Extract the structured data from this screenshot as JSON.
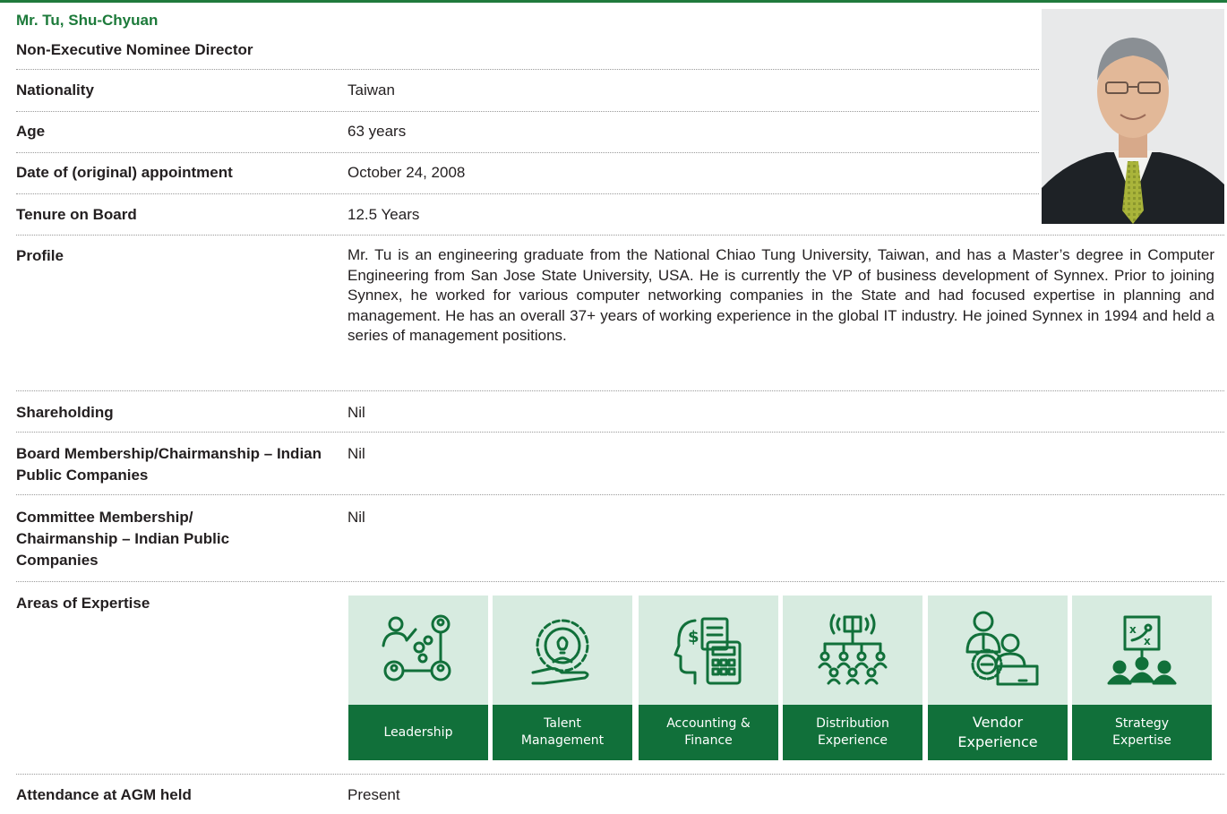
{
  "header": {
    "name": "Mr. Tu, Shu-Chyuan",
    "role": "Non-Executive Nominee Director"
  },
  "rows": [
    {
      "label": "Nationality",
      "value": "Taiwan"
    },
    {
      "label": "Age",
      "value": "63 years"
    },
    {
      "label": "Date of (original) appointment",
      "value": "October 24, 2008"
    },
    {
      "label": "Tenure on Board",
      "value": "12.5 Years"
    },
    {
      "label": "Profile",
      "value": "Mr. Tu is an engineering graduate from the National Chiao Tung University, Taiwan, and has a Master’s degree in Computer Engineering from San Jose State University, USA. He is currently the VP of business development of Synnex. Prior to joining Synnex, he worked for various computer networking companies in the State and had focused expertise in planning and management. He has an overall 37+ years of working experience in the global IT industry. He joined Synnex in 1994 and held a series of management positions."
    },
    {
      "label": "Shareholding",
      "value": "Nil"
    },
    {
      "label": "Board Membership/Chairmanship – Indian Public Companies",
      "value": "Nil"
    },
    {
      "label": "Committee Membership/ Chairmanship – Indian Public Companies",
      "value": "Nil"
    },
    {
      "label": "Areas of Expertise",
      "value": ""
    },
    {
      "label": "Attendance at AGM held",
      "value": "Present"
    }
  ],
  "expertise": [
    {
      "label": "Leadership",
      "icon": "leadership-icon"
    },
    {
      "label": "Talent\nManagement",
      "icon": "talent-management-icon"
    },
    {
      "label": "Accounting &\nFinance",
      "icon": "accounting-finance-icon"
    },
    {
      "label": "Distribution\nExperience",
      "icon": "distribution-icon"
    },
    {
      "label": "Vendor\nExperience",
      "icon": "vendor-icon"
    },
    {
      "label": "Strategy\nExpertise",
      "icon": "strategy-icon"
    }
  ],
  "colors": {
    "brand_green": "#11703a",
    "name_green": "#1c7a3a",
    "tile_bg": "#d7ebe0"
  }
}
